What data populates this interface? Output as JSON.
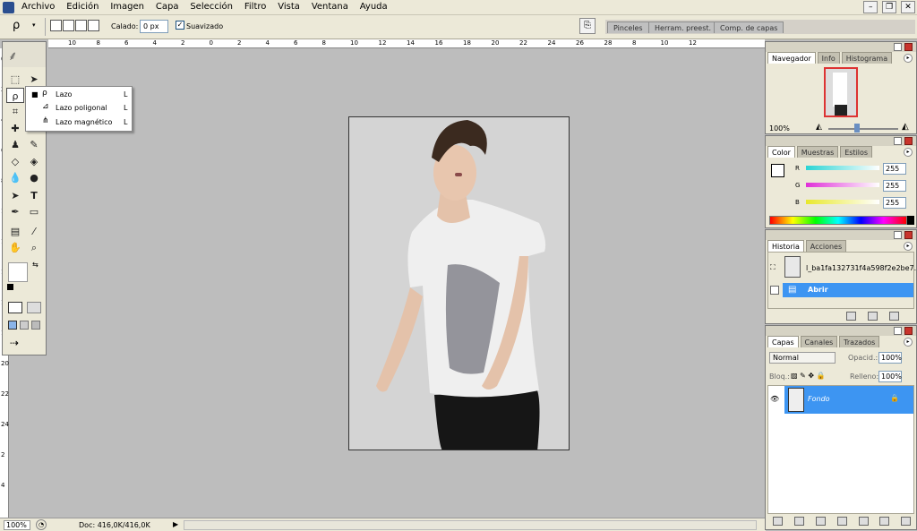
{
  "menubar": {
    "items": [
      "Archivo",
      "Edición",
      "Imagen",
      "Capa",
      "Selección",
      "Filtro",
      "Vista",
      "Ventana",
      "Ayuda"
    ]
  },
  "options": {
    "calado_label": "Calado:",
    "calado_value": "0 px",
    "suavizado_label": "Suavizado",
    "suavizado_checked": "✓"
  },
  "palette_well": {
    "tabs": [
      "Pinceles",
      "Herram. preest.",
      "Comp. de capas"
    ]
  },
  "ruler_top_numbers": [
    "10",
    "8",
    "6",
    "4",
    "2",
    "0",
    "2",
    "4",
    "6",
    "8",
    "10",
    "12",
    "14",
    "16",
    "18",
    "20",
    "22",
    "24",
    "26",
    "28",
    "8",
    "10",
    "12"
  ],
  "ruler_left_numbers": [
    "0",
    "2",
    "4",
    "6",
    "8",
    "10",
    "12",
    "14",
    "16",
    "18",
    "20",
    "22",
    "24",
    "2",
    "4"
  ],
  "tool_flyout": {
    "items": [
      {
        "label": "Lazo",
        "key": "L",
        "selected": "■"
      },
      {
        "label": "Lazo poligonal",
        "key": "L",
        "selected": ""
      },
      {
        "label": "Lazo magnético",
        "key": "L",
        "selected": ""
      }
    ]
  },
  "status": {
    "zoom": "100%",
    "doc": "Doc: 416,0K/416,0K"
  },
  "navigator": {
    "tabs": [
      "Navegador",
      "Info",
      "Histograma"
    ],
    "zoom": "100%"
  },
  "color": {
    "tabs": [
      "Color",
      "Muestras",
      "Estilos"
    ],
    "channels": [
      {
        "name": "R",
        "value": "255",
        "color": "#2ad4d4"
      },
      {
        "name": "G",
        "value": "255",
        "color": "#e030d8"
      },
      {
        "name": "B",
        "value": "255",
        "color": "#e8e82c"
      }
    ]
  },
  "history": {
    "tabs": [
      "Historia",
      "Acciones"
    ],
    "snapshot": "l_ba1fa132731f4a598f2e2be7...",
    "step": "Abrir"
  },
  "layers": {
    "tabs": [
      "Capas",
      "Canales",
      "Trazados"
    ],
    "blend_mode": "Normal",
    "opacity_label": "Opacid.:",
    "opacity": "100%",
    "lock_label": "Bloq.:",
    "fill_label": "Relleno:",
    "fill": "100%",
    "layer_name": "Fondo"
  },
  "colors": {
    "selection_blue": "#3d95f2",
    "ui_bg": "#ece9d8",
    "canvas_bg": "#bdbdbd"
  }
}
